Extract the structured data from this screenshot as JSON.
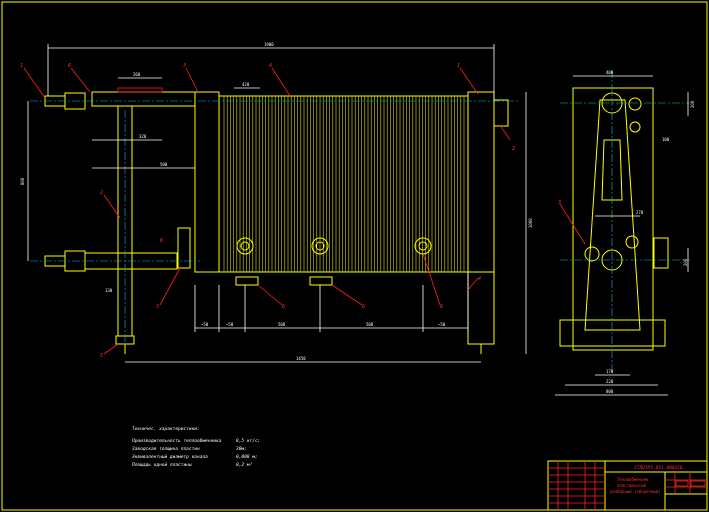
{
  "title_block": {
    "doc_code": "ЗТЛОТПЭ.051.0001СБ",
    "name_line1": "Теплообменник",
    "name_line2": "пластинчатый",
    "name_line3": "разборный (сборочный)"
  },
  "tech": {
    "heading": "Техничес. характеристики:",
    "rows": [
      {
        "label": "Производительность теплообменника",
        "value": "8,5 кг/с;"
      },
      {
        "label": "Заводская толщина пластин",
        "value": "30м;"
      },
      {
        "label": "Эквивалентный диаметр канала",
        "value": "0,008 м;"
      },
      {
        "label": "Площадь одной пластины",
        "value": "0,2 м²"
      }
    ]
  },
  "callouts": [
    "1",
    "6",
    "3",
    "4",
    "1",
    "2",
    "2",
    "3",
    "6",
    "6",
    "6",
    "6",
    "5",
    "4",
    "3"
  ],
  "dims": {
    "overall_top": "1900",
    "top_a": "260",
    "top_b": "420",
    "top_c": "320",
    "mid": "500",
    "left_v": "800",
    "right_v": "1000",
    "bottom_total": "1450",
    "b1": "~50",
    "b2": "~50",
    "b3": "500",
    "b4": "500",
    "b5": "~50",
    "b6": "130",
    "side_top": "400",
    "side_r1": "200",
    "side_r2": "100",
    "side_m": "270",
    "side_r3": "200",
    "side_b1": "170",
    "side_b2": "220",
    "side_b3": "800"
  }
}
